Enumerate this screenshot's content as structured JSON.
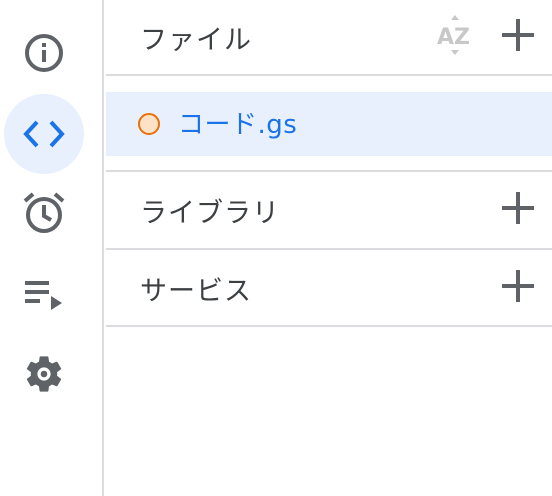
{
  "rail": {
    "items": [
      {
        "name": "overview",
        "icon": "info-icon"
      },
      {
        "name": "editor",
        "icon": "code-icon",
        "active": true
      },
      {
        "name": "triggers",
        "icon": "alarm-icon"
      },
      {
        "name": "executions",
        "icon": "playlist-play-icon"
      },
      {
        "name": "settings",
        "icon": "gear-icon"
      }
    ],
    "active_color": "#e8f0fe",
    "icon_color": "#5f6368",
    "active_icon_color": "#1a73e8"
  },
  "files": {
    "title": "ファイル",
    "items": [
      {
        "name": "コード.gs",
        "status_color": "#e8710a"
      }
    ]
  },
  "libraries": {
    "title": "ライブラリ"
  },
  "services": {
    "title": "サービス"
  },
  "sort": {
    "icon": "sort-az-icon",
    "top_letter": "A",
    "bottom_letter": "Z"
  }
}
